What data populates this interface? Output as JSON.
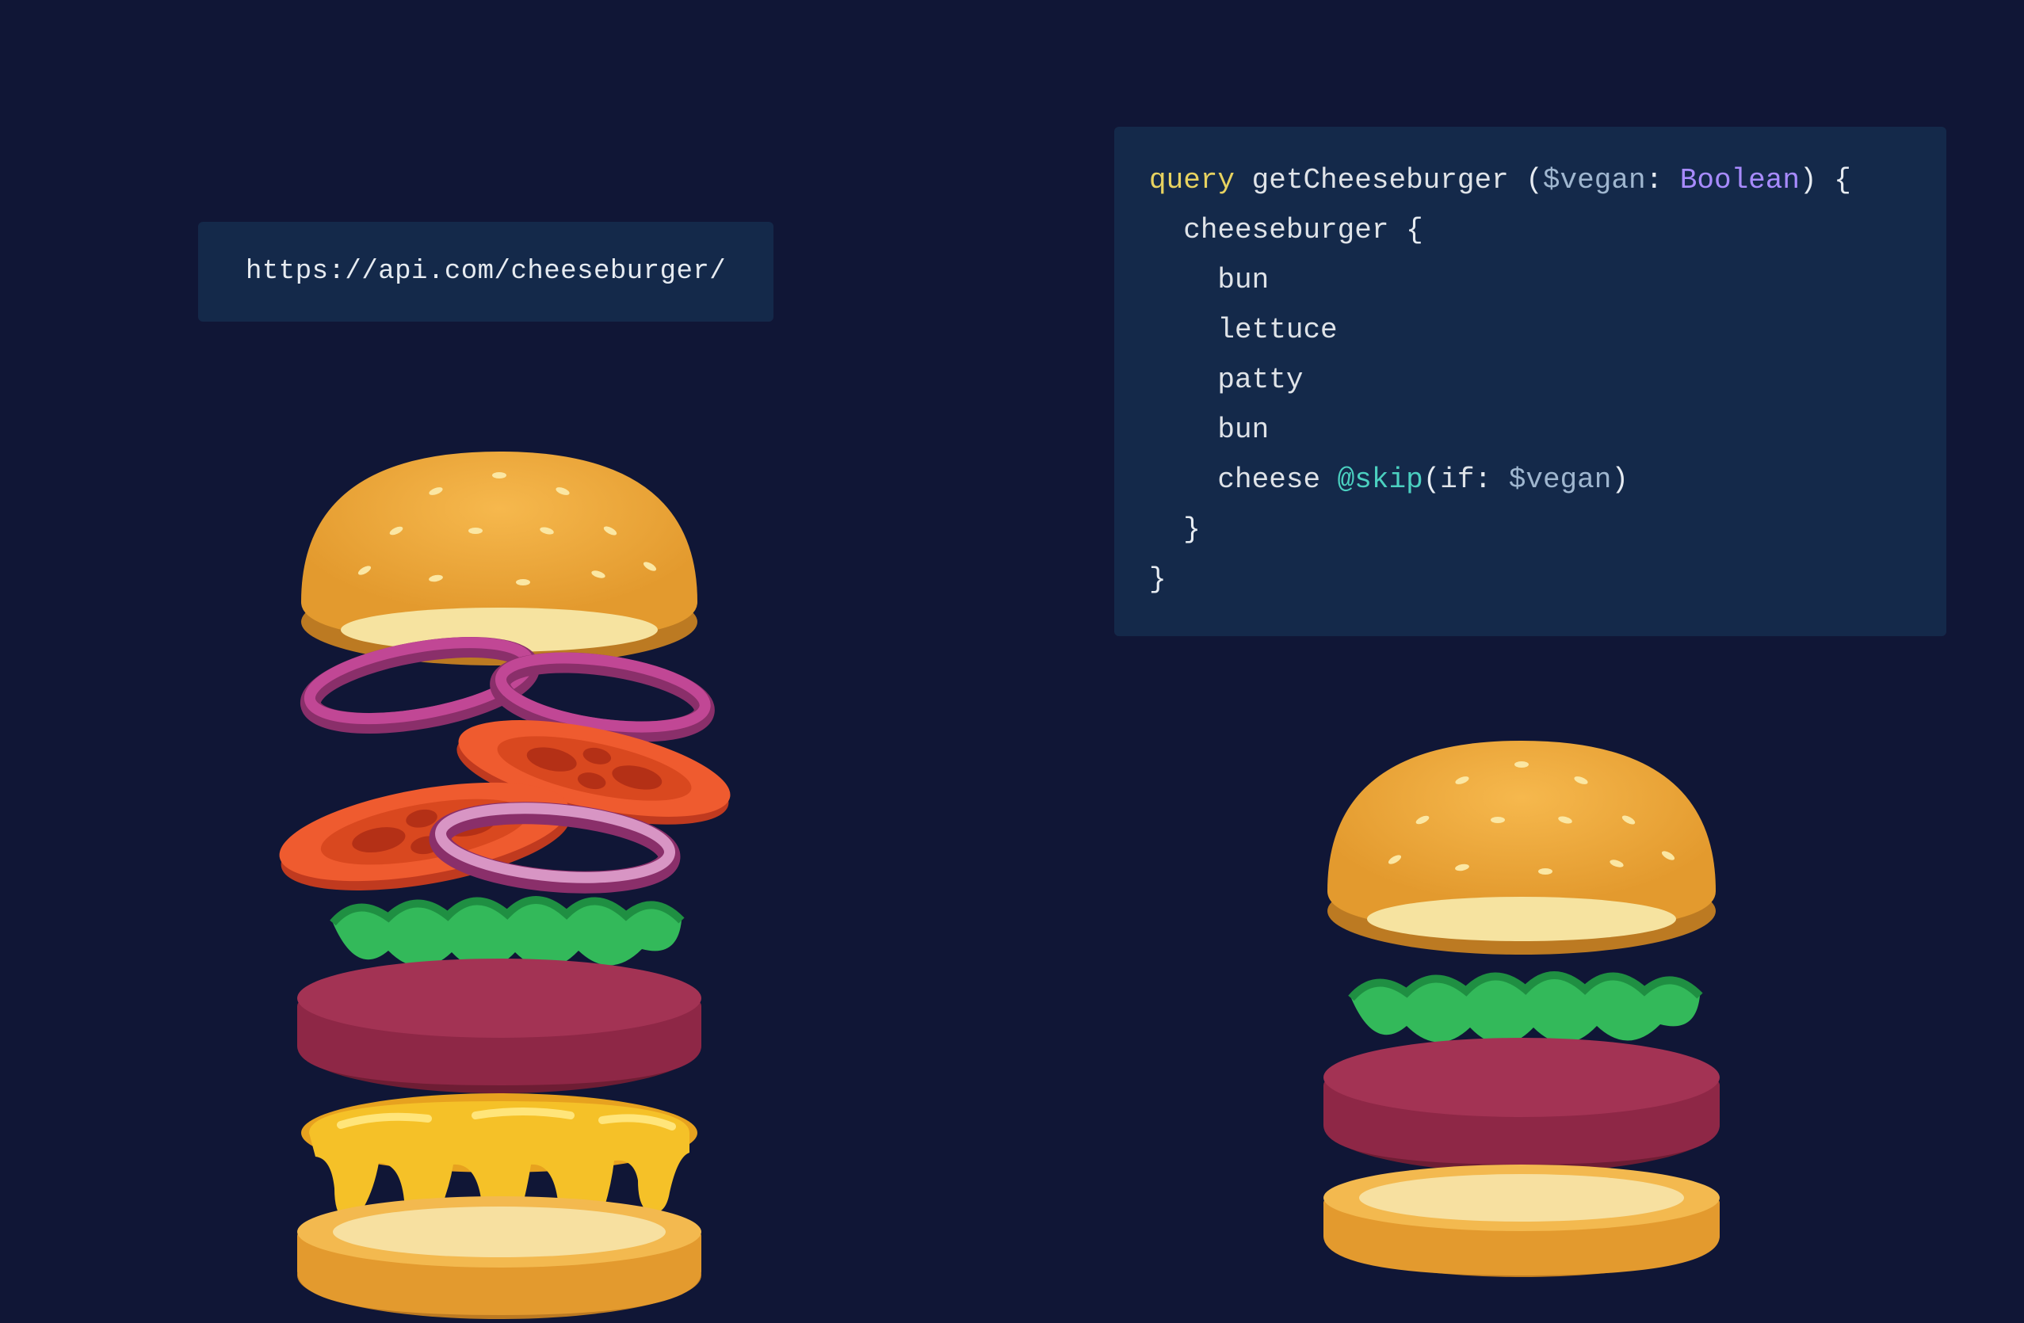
{
  "rest": {
    "url": "https://api.com/cheeseburger/"
  },
  "graphql": {
    "keyword": "query",
    "operation_name": "getCheeseburger",
    "var_name": "$vegan",
    "var_type": "Boolean",
    "root_field": "cheeseburger",
    "fields": [
      "bun",
      "lettuce",
      "patty",
      "bun"
    ],
    "cheese_field": "cheese",
    "directive": "@skip",
    "directive_arg_name": "if",
    "directive_arg_value": "$vegan"
  }
}
